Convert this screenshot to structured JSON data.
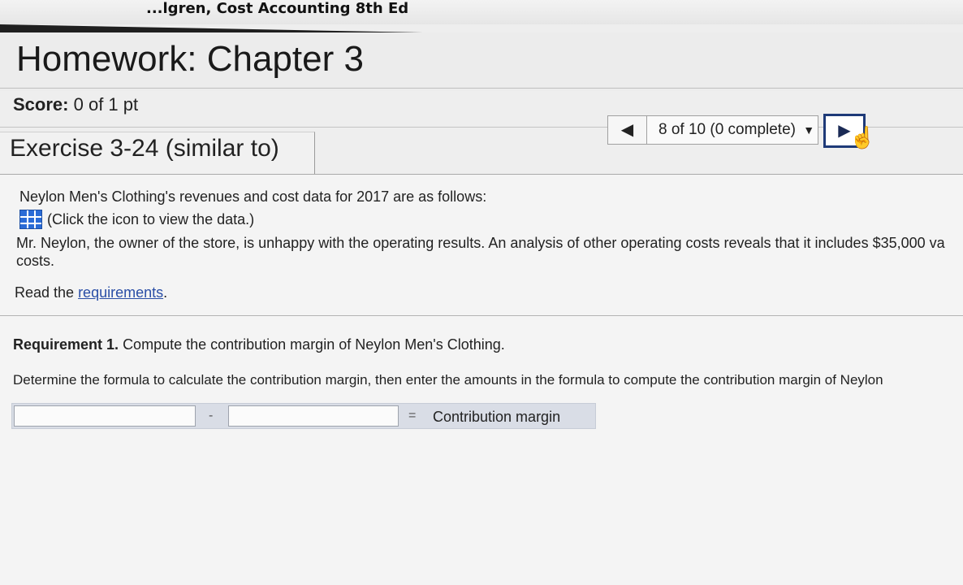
{
  "header": {
    "course_title": "...lgren, Cost Accounting 8th Ed",
    "homework_title": "Homework: Chapter 3"
  },
  "score": {
    "label": "Score:",
    "value": "0 of 1 pt"
  },
  "exercise": {
    "title": "Exercise 3-24 (similar to)"
  },
  "navigation": {
    "prev_icon": "◀",
    "status": "8 of 10 (0 complete)",
    "dropdown_icon": "▼",
    "next_icon": "▶"
  },
  "question": {
    "intro": "Neylon Men's Clothing's revenues and cost data for 2017 are as follows:",
    "data_link": "(Click the icon to view the data.)",
    "analysis_line1": "Mr. Neylon, the owner of the store, is unhappy with the operating results. An analysis of other operating costs reveals that it includes $35,000 va",
    "analysis_line2": "costs.",
    "read_prefix": "Read the ",
    "requirements_link": "requirements",
    "read_suffix": "."
  },
  "requirement1": {
    "label": "Requirement 1.",
    "text": "Compute the contribution margin of Neylon Men's Clothing.",
    "instruction": "Determine the formula to calculate the contribution margin, then enter the amounts in the formula to compute the contribution margin of Neylon",
    "formula": {
      "input1_value": "",
      "operator": "-",
      "input2_value": "",
      "equals": "=",
      "result_label": "Contribution margin"
    }
  }
}
